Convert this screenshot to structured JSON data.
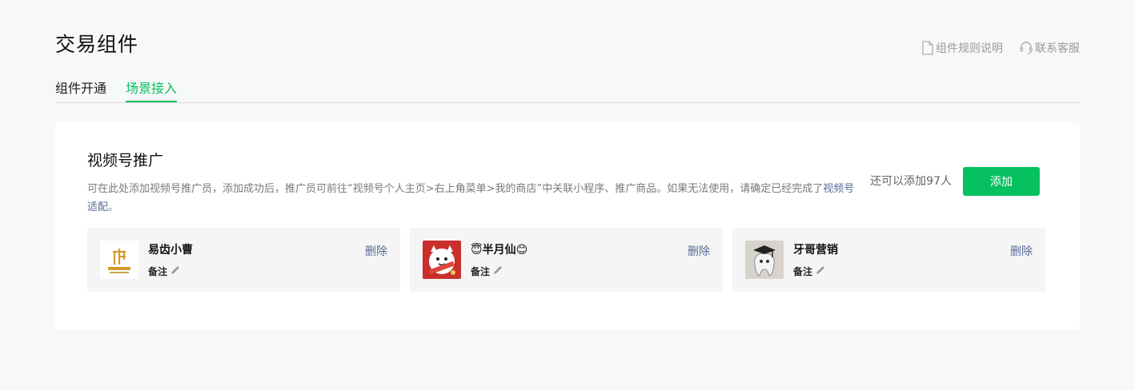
{
  "header": {
    "title": "交易组件",
    "links": [
      {
        "label": "组件规则说明",
        "icon": "document-icon"
      },
      {
        "label": "联系客服",
        "icon": "headset-icon"
      }
    ]
  },
  "tabs": [
    {
      "label": "组件开通",
      "active": false
    },
    {
      "label": "场景接入",
      "active": true
    }
  ],
  "section": {
    "title": "视频号推广",
    "description": "可在此处添加视频号推广员，添加成功后，推广员可前往“视频号个人主页>右上角菜单>我的商店”中关联小程序、推广商品。如果无法使用，请确定已经完成了",
    "description_link": "视频号适配",
    "description_end": "。",
    "remaining": "还可以添加97人",
    "add_label": "添加"
  },
  "promoters": [
    {
      "name": "易齿小曹",
      "note_label": "备注",
      "delete_label": "删除",
      "avatar": "dental-logo-avatar"
    },
    {
      "name": "😇半月仙😊",
      "note_label": "备注",
      "delete_label": "删除",
      "avatar": "cartoon-avatar"
    },
    {
      "name": "牙哥营销",
      "note_label": "备注",
      "delete_label": "删除",
      "avatar": "tooth-graduate-avatar"
    }
  ],
  "colors": {
    "accent": "#07c160",
    "link": "#576b95",
    "background": "#f7f8fa"
  }
}
